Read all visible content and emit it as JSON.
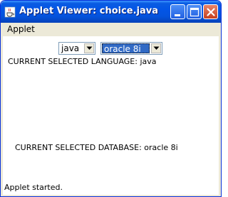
{
  "window": {
    "title": "Applet Viewer: choice.java",
    "icon": "java-cup-icon"
  },
  "menubar": {
    "items": [
      {
        "label": "Applet"
      }
    ]
  },
  "applet": {
    "language_choice": {
      "selected": "java"
    },
    "database_choice": {
      "selected": "oracle 8i"
    },
    "language_label": "CURRENT SELECTED LANGUAGE: java",
    "database_label": "CURRENT SELECTED DATABASE: oracle 8i"
  },
  "status": {
    "text": "Applet started."
  },
  "colors": {
    "titlebar": "#0355e6",
    "selection": "#316ac5",
    "close_button": "#c6401f"
  }
}
